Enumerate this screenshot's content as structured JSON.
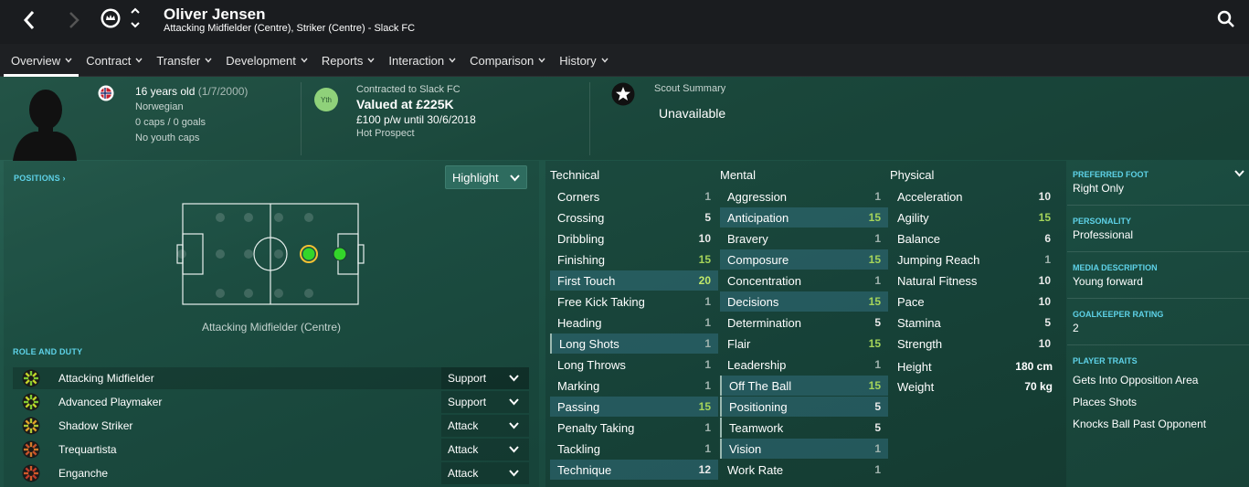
{
  "player": {
    "name": "Oliver Jensen",
    "subtitle": "Attacking Midfielder (Centre), Striker (Centre) - Slack FC"
  },
  "nav": {
    "tabs": [
      {
        "label": "Overview"
      },
      {
        "label": "Contract"
      },
      {
        "label": "Transfer"
      },
      {
        "label": "Development"
      },
      {
        "label": "Reports"
      },
      {
        "label": "Interaction"
      },
      {
        "label": "Comparison"
      },
      {
        "label": "History"
      }
    ]
  },
  "info": {
    "age": "16 years old",
    "dob": "(1/7/2000)",
    "nationality": "Norwegian",
    "caps": "0 caps / 0 goals",
    "youth_caps": "No youth caps",
    "youth_badge": "Yth",
    "contract": "Contracted to Slack FC",
    "value": "Valued at £225K",
    "wage": "£100 p/w until 30/6/2018",
    "status": "Hot Prospect",
    "scout_label": "Scout Summary",
    "scout_value": "Unavailable"
  },
  "positions": {
    "label": "POSITIONS",
    "highlight": "Highlight",
    "current": "Attacking Midfielder (Centre)"
  },
  "roles": {
    "label": "ROLE AND DUTY",
    "items": [
      {
        "name": "Attacking Midfielder",
        "duty": "Support"
      },
      {
        "name": "Advanced Playmaker",
        "duty": "Support"
      },
      {
        "name": "Shadow Striker",
        "duty": "Attack"
      },
      {
        "name": "Trequartista",
        "duty": "Attack"
      },
      {
        "name": "Enganche",
        "duty": "Attack"
      }
    ]
  },
  "technical": {
    "title": "Technical",
    "items": [
      {
        "name": "Corners",
        "value": "1"
      },
      {
        "name": "Crossing",
        "value": "5"
      },
      {
        "name": "Dribbling",
        "value": "10"
      },
      {
        "name": "Finishing",
        "value": "15"
      },
      {
        "name": "First Touch",
        "value": "20"
      },
      {
        "name": "Free Kick Taking",
        "value": "1"
      },
      {
        "name": "Heading",
        "value": "1"
      },
      {
        "name": "Long Shots",
        "value": "1"
      },
      {
        "name": "Long Throws",
        "value": "1"
      },
      {
        "name": "Marking",
        "value": "1"
      },
      {
        "name": "Passing",
        "value": "15"
      },
      {
        "name": "Penalty Taking",
        "value": "1"
      },
      {
        "name": "Tackling",
        "value": "1"
      },
      {
        "name": "Technique",
        "value": "12"
      }
    ]
  },
  "mental": {
    "title": "Mental",
    "items": [
      {
        "name": "Aggression",
        "value": "1"
      },
      {
        "name": "Anticipation",
        "value": "15"
      },
      {
        "name": "Bravery",
        "value": "1"
      },
      {
        "name": "Composure",
        "value": "15"
      },
      {
        "name": "Concentration",
        "value": "1"
      },
      {
        "name": "Decisions",
        "value": "15"
      },
      {
        "name": "Determination",
        "value": "5"
      },
      {
        "name": "Flair",
        "value": "15"
      },
      {
        "name": "Leadership",
        "value": "1"
      },
      {
        "name": "Off The Ball",
        "value": "15"
      },
      {
        "name": "Positioning",
        "value": "5"
      },
      {
        "name": "Teamwork",
        "value": "5"
      },
      {
        "name": "Vision",
        "value": "1"
      },
      {
        "name": "Work Rate",
        "value": "1"
      }
    ]
  },
  "physical": {
    "title": "Physical",
    "items": [
      {
        "name": "Acceleration",
        "value": "10"
      },
      {
        "name": "Agility",
        "value": "15"
      },
      {
        "name": "Balance",
        "value": "6"
      },
      {
        "name": "Jumping Reach",
        "value": "1"
      },
      {
        "name": "Natural Fitness",
        "value": "10"
      },
      {
        "name": "Pace",
        "value": "10"
      },
      {
        "name": "Stamina",
        "value": "5"
      },
      {
        "name": "Strength",
        "value": "10"
      }
    ],
    "height_label": "Height",
    "height": "180 cm",
    "weight_label": "Weight",
    "weight": "70 kg"
  },
  "profile": {
    "foot_label": "PREFERRED FOOT",
    "foot": "Right Only",
    "personality_label": "PERSONALITY",
    "personality": "Professional",
    "media_label": "MEDIA DESCRIPTION",
    "media": "Young forward",
    "gk_label": "GOALKEEPER RATING",
    "gk": "2",
    "traits_label": "PLAYER TRAITS",
    "traits": [
      "Gets Into Opposition Area",
      "Places Shots",
      "Knocks Ball Past Opponent"
    ]
  },
  "colors": {
    "accent": "#5ed2e8",
    "green": "#a5d45a",
    "pitch_dot": "#33d62a",
    "panel": "#1e2023"
  }
}
